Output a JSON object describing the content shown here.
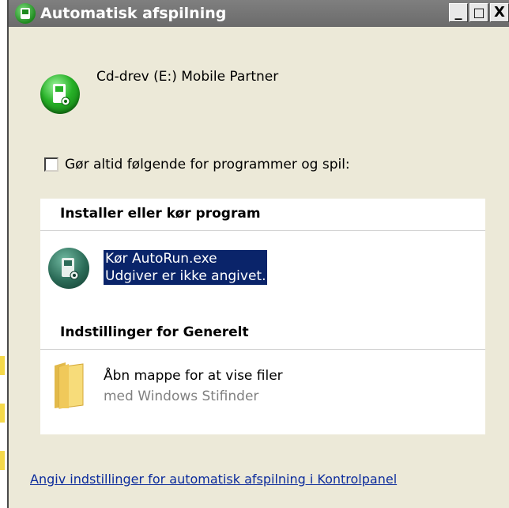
{
  "window": {
    "title": "Automatisk afspilning",
    "title_buttons": [
      "_",
      "□",
      "X"
    ]
  },
  "device": {
    "name": "Cd-drev (E:) Mobile Partner",
    "icon": "mobile-partner-icon"
  },
  "always_option": {
    "label": "Gør altid følgende for programmer og spil:",
    "checked": false
  },
  "sections": {
    "install": {
      "header": "Installer eller kør program",
      "items": [
        {
          "title": "Kør AutoRun.exe",
          "subtitle": "Udgiver er ikke angivet.",
          "selected": true,
          "icon": "autorun-app-icon"
        }
      ]
    },
    "general": {
      "header": "Indstillinger for Generelt",
      "items": [
        {
          "title": "Åbn mappe for at vise filer",
          "subtitle": "med Windows Stifinder",
          "icon": "folder-icon"
        }
      ]
    }
  },
  "footer": {
    "link": "Angiv indstillinger for automatisk afspilning i Kontrolpanel"
  },
  "colors": {
    "selection_bg": "#0a246a",
    "link": "#0b2b9c",
    "dialog_bg": "#ece9d8"
  }
}
